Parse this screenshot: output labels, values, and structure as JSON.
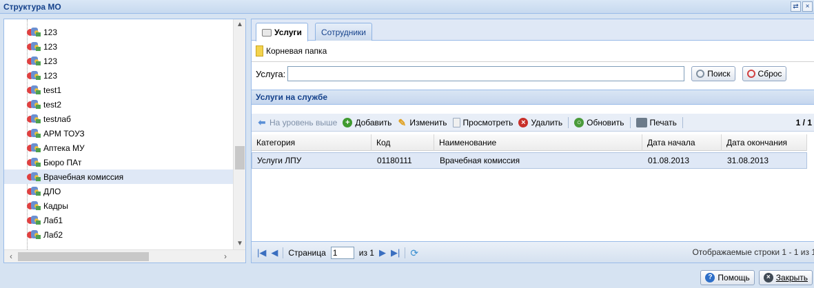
{
  "window": {
    "title": "Структура МО",
    "tools": [
      "⇄",
      "×"
    ]
  },
  "tree": {
    "items": [
      {
        "label": "123"
      },
      {
        "label": "123"
      },
      {
        "label": "123"
      },
      {
        "label": "123"
      },
      {
        "label": "test1"
      },
      {
        "label": "test2"
      },
      {
        "label": "testлаб"
      },
      {
        "label": "АРМ ТОУЗ"
      },
      {
        "label": "Аптека МУ"
      },
      {
        "label": "Бюро ПАт"
      },
      {
        "label": "Врачебная комиссия",
        "selected": true
      },
      {
        "label": "ДЛО"
      },
      {
        "label": "Кадры"
      },
      {
        "label": "Лаб1"
      },
      {
        "label": "Лаб2"
      }
    ]
  },
  "tabs": [
    {
      "label": "Услуги",
      "active": true
    },
    {
      "label": "Сотрудники",
      "active": false
    }
  ],
  "folder": {
    "label": "Корневая папка"
  },
  "search": {
    "label": "Услуга:",
    "value": "",
    "search_button": "Поиск",
    "reset_button": "Сброс"
  },
  "grid": {
    "title": "Услуги на службе",
    "toolbar": {
      "up_level": "На уровень выше",
      "add": "Добавить",
      "edit": "Изменить",
      "view": "Просмотреть",
      "delete": "Удалить",
      "refresh": "Обновить",
      "print": "Печать",
      "counter": "1 / 1"
    },
    "columns": [
      "Категория",
      "Код",
      "Наименование",
      "Дата начала",
      "Дата окончания"
    ],
    "rows": [
      [
        "Услуги ЛПУ",
        "01180111",
        "Врачебная комиссия",
        "01.08.2013",
        "31.08.2013"
      ]
    ]
  },
  "pager": {
    "page_label": "Страница",
    "page_value": "1",
    "of_label": "из 1",
    "info": "Отображаемые строки 1 - 1 из 1"
  },
  "footer": {
    "help_button": "Помощь",
    "close_button": "Закрыть"
  }
}
